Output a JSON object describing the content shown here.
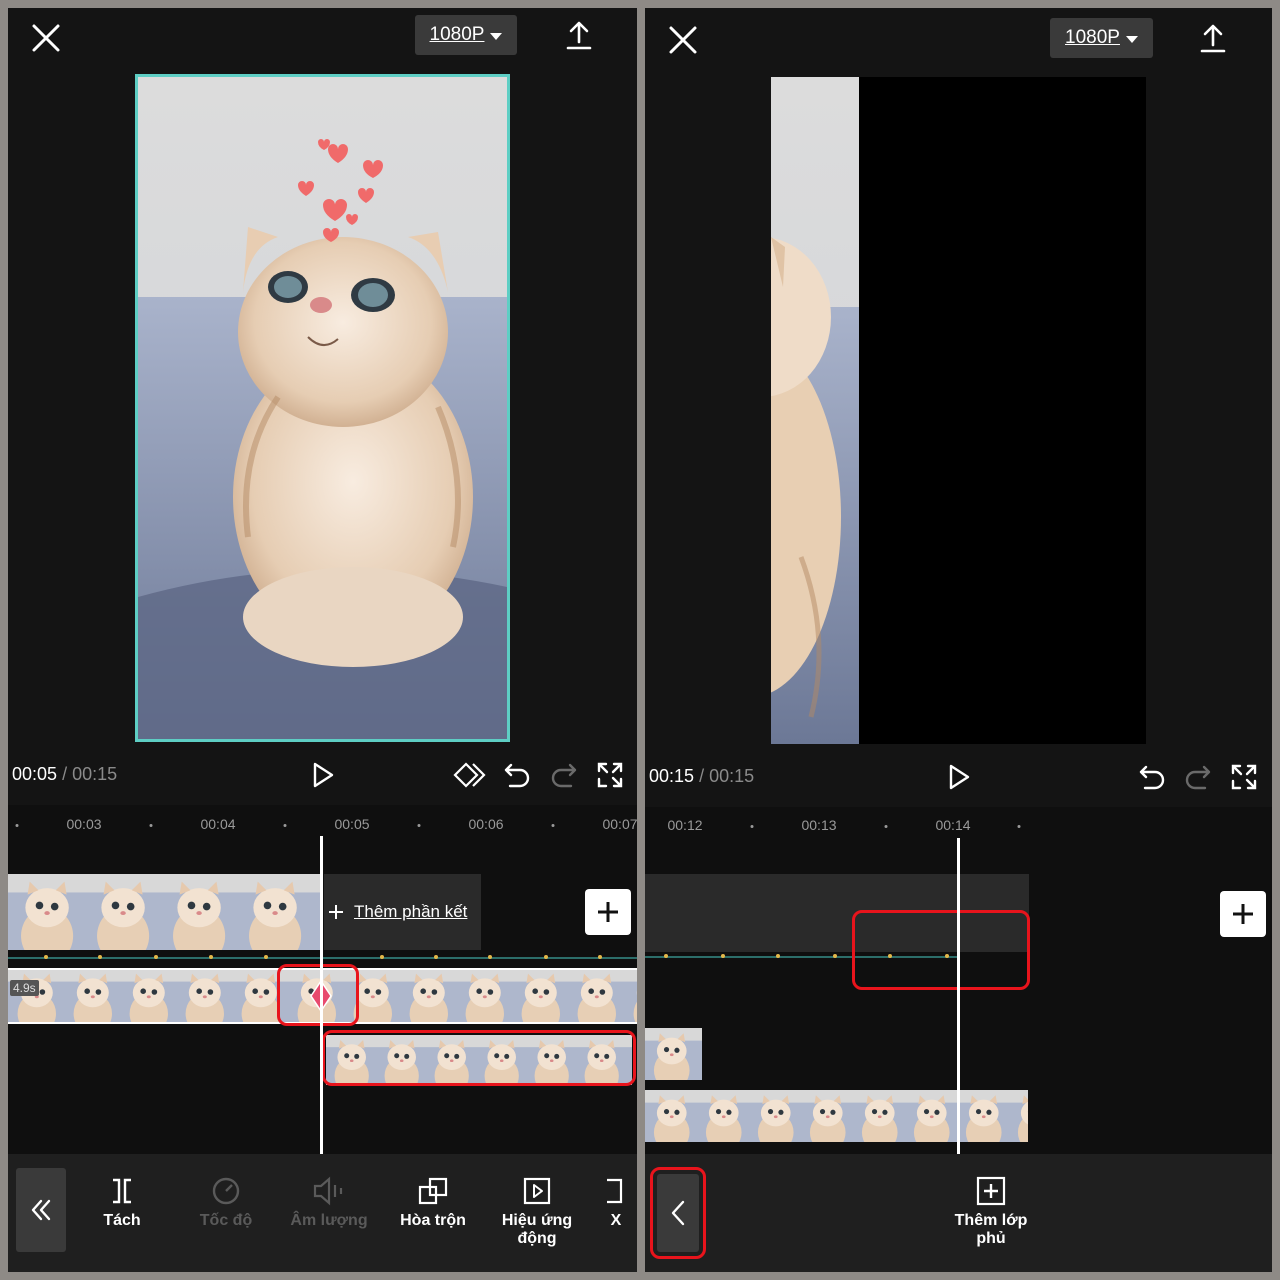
{
  "left": {
    "resolution": "1080P",
    "time_current": "00:05",
    "time_separator": "/",
    "time_total": "00:15",
    "ruler_labels": [
      "00:03",
      "00:04",
      "00:05",
      "00:06",
      "00:07"
    ],
    "add_ending_label": "Thêm phần kết",
    "clip_duration_badge": "4.9s",
    "toolbar": {
      "split": "Tách",
      "speed": "Tốc độ",
      "volume": "Âm lượng",
      "blend": "Hòa trộn",
      "animation": "Hiệu ứng động",
      "more": "X"
    }
  },
  "right": {
    "resolution": "1080P",
    "time_current": "00:15",
    "time_separator": "/",
    "time_total": "00:15",
    "ruler_labels": [
      "00:12",
      "00:13",
      "00:14"
    ],
    "toolbar": {
      "add_overlay": "Thêm lớp phủ"
    }
  },
  "colors": {
    "panel_bg": "#141414",
    "highlight_red": "#e8141c",
    "selection_teal": "#5ecec4",
    "keyframe_pink": "#e84a6e"
  },
  "icons": [
    "close-icon",
    "export-icon",
    "play-icon",
    "keyframe-icon",
    "undo-icon",
    "redo-icon",
    "fullscreen-icon",
    "collapse-icon",
    "split-icon",
    "speed-icon",
    "volume-icon",
    "blend-icon",
    "animation-icon",
    "back-icon",
    "add-overlay-icon",
    "plus-icon"
  ]
}
